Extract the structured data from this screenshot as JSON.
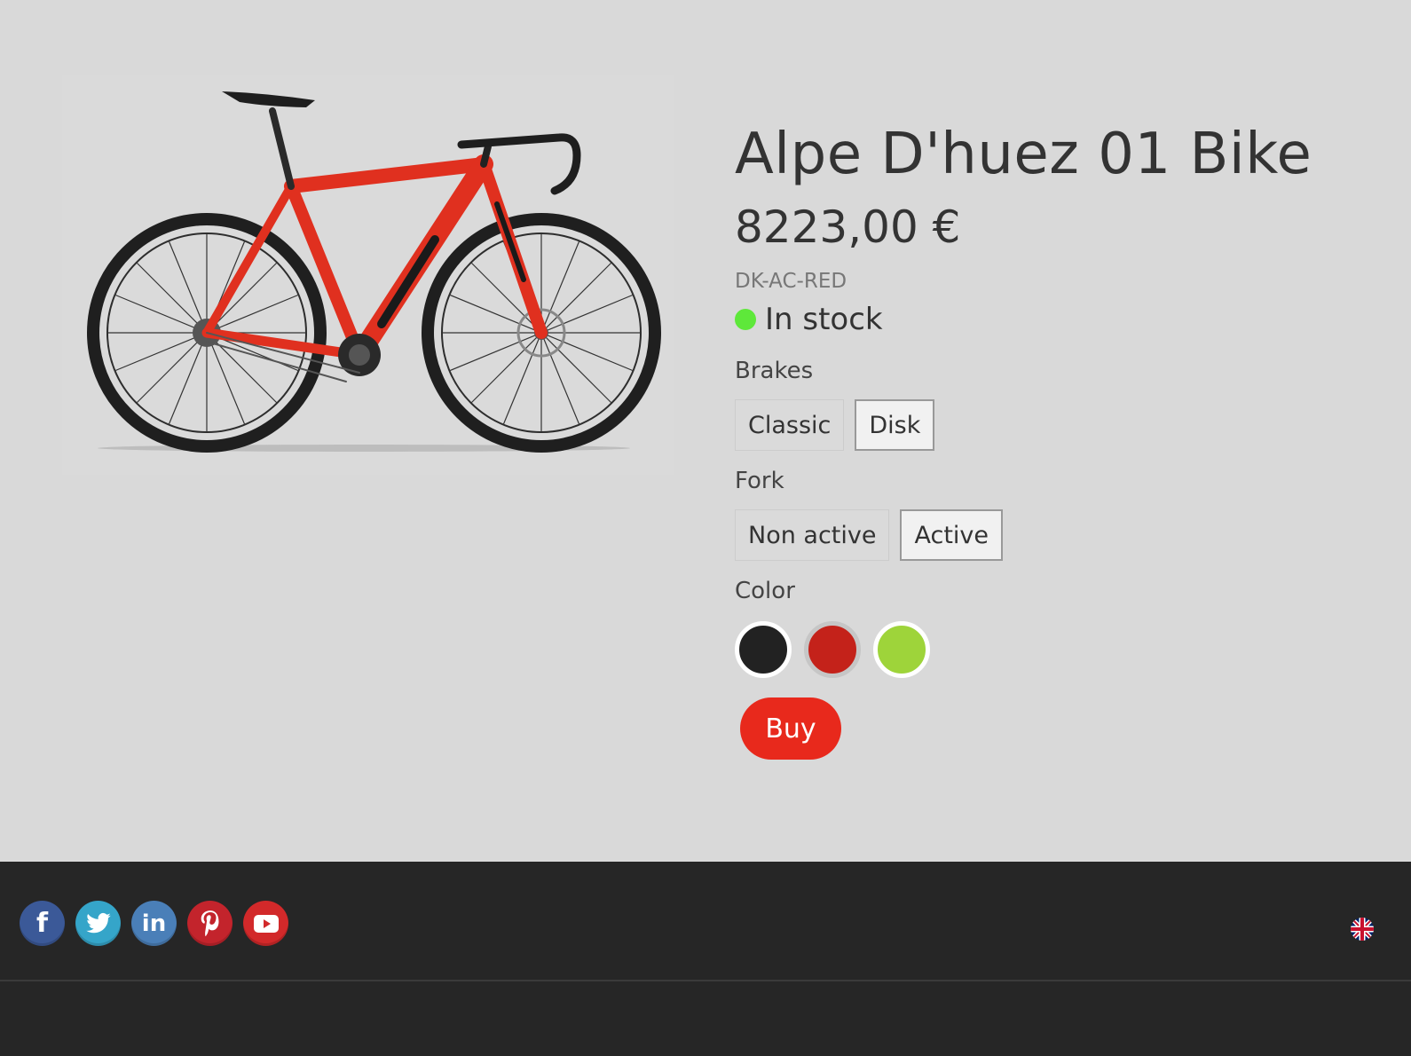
{
  "product": {
    "title": "Alpe D'huez 01 Bike",
    "price": "8223,00 €",
    "sku": "DK-AC-RED",
    "stock": {
      "text": "In stock",
      "color": "#5ee83a"
    },
    "image": {
      "description_icon": "road-bike-image",
      "frame_color": "#e0301f"
    }
  },
  "options": {
    "brakes": {
      "label": "Brakes",
      "values": [
        "Classic",
        "Disk"
      ],
      "selected": "Disk"
    },
    "fork": {
      "label": "Fork",
      "values": [
        "Non active",
        "Active"
      ],
      "selected": "Active"
    },
    "color": {
      "label": "Color",
      "swatches": [
        {
          "name": "black",
          "hex": "#222222"
        },
        {
          "name": "red",
          "hex": "#c4221a",
          "selected": true
        },
        {
          "name": "green",
          "hex": "#9ed43a"
        }
      ]
    }
  },
  "buy": {
    "label": "Buy",
    "color": "#e8291c"
  },
  "footer": {
    "socials": [
      {
        "icon": "facebook-icon",
        "glyph": "f",
        "color": "#3b5998"
      },
      {
        "icon": "twitter-icon",
        "glyph": "",
        "color": "#35a5c9"
      },
      {
        "icon": "linkedin-icon",
        "glyph": "in",
        "color": "#4a7fb8"
      },
      {
        "icon": "pinterest-icon",
        "glyph": "P",
        "color": "#c3242c"
      },
      {
        "icon": "youtube-icon",
        "glyph": "",
        "color": "#d2292a"
      }
    ],
    "language_icon": "uk-flag-icon"
  }
}
